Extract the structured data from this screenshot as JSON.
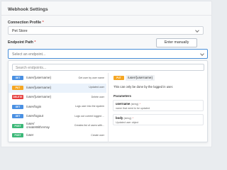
{
  "title": "Webhook Settings",
  "connection": {
    "label": "Connection Profile",
    "required_mark": "*",
    "value": "Pet Store"
  },
  "endpoint": {
    "label": "Endpoint Path",
    "required_mark": "*",
    "enter_manually": "Enter manually",
    "placeholder": "Select an endpoint..."
  },
  "search_placeholder": "Search endpoints...",
  "endpoints": [
    {
      "method": "GET",
      "color": "#4a90e2",
      "path": "/user/{username}",
      "desc": "Get user by user name",
      "active": false
    },
    {
      "method": "PUT",
      "color": "#f5a623",
      "path": "/user/{username}",
      "desc": "Updated user",
      "active": true
    },
    {
      "method": "DELETE",
      "color": "#e53e3e",
      "path": "/user/{username}",
      "desc": "Delete user",
      "active": false
    },
    {
      "method": "GET",
      "color": "#4a90e2",
      "path": "/user/login",
      "desc": "Logs user into the system",
      "active": false
    },
    {
      "method": "GET",
      "color": "#4a90e2",
      "path": "/user/logout",
      "desc": "Logs out current logged ...",
      "active": false
    },
    {
      "method": "POST",
      "color": "#3cb878",
      "path": "/user/\ncreateWithArray",
      "desc": "Creates list of users with...",
      "active": false
    },
    {
      "method": "POST",
      "color": "#3cb878",
      "path": "/user",
      "desc": "Create user",
      "active": false
    }
  ],
  "detail": {
    "method": "PUT",
    "color": "#f5a623",
    "path": "/user/{username}",
    "description": "This can only be done by the logged in user.",
    "params_heading": "Parameters",
    "params": [
      {
        "name": "username",
        "type": "(string)",
        "req": "*",
        "desc": "name that need to be updated"
      },
      {
        "name": "body",
        "type": "(string)",
        "req": "*",
        "desc": "Updated user object"
      }
    ]
  }
}
